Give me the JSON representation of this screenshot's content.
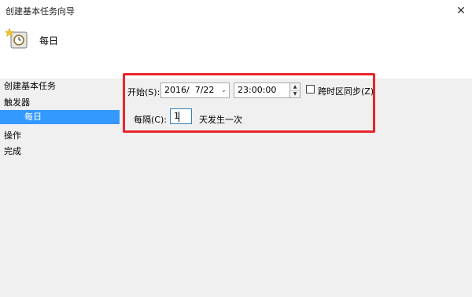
{
  "window": {
    "title": "创建基本任务向导",
    "close_label": "✕"
  },
  "header": {
    "title": "每日",
    "icon": "scheduled-task-clock-icon"
  },
  "sidebar": {
    "items": [
      {
        "label": "创建基本任务"
      },
      {
        "label": "触发器"
      },
      {
        "label": "每日"
      },
      {
        "label": "操作"
      },
      {
        "label": "完成"
      }
    ]
  },
  "form": {
    "start_label": "开始(S):",
    "start_date": "2016/  7/22",
    "date_dropdown_icon": "chevron-down-icon",
    "start_time": "23:00:00",
    "spinner_icons": [
      "triangle-up-icon",
      "triangle-down-icon"
    ],
    "sync_label": "跨时区同步(Z)",
    "sync_checked": false,
    "recur_label": "每隔(C):",
    "recur_value": "1",
    "recur_suffix": "天发生一次"
  },
  "highlight_color": "#e8262a",
  "selection_color": "#3399ff"
}
